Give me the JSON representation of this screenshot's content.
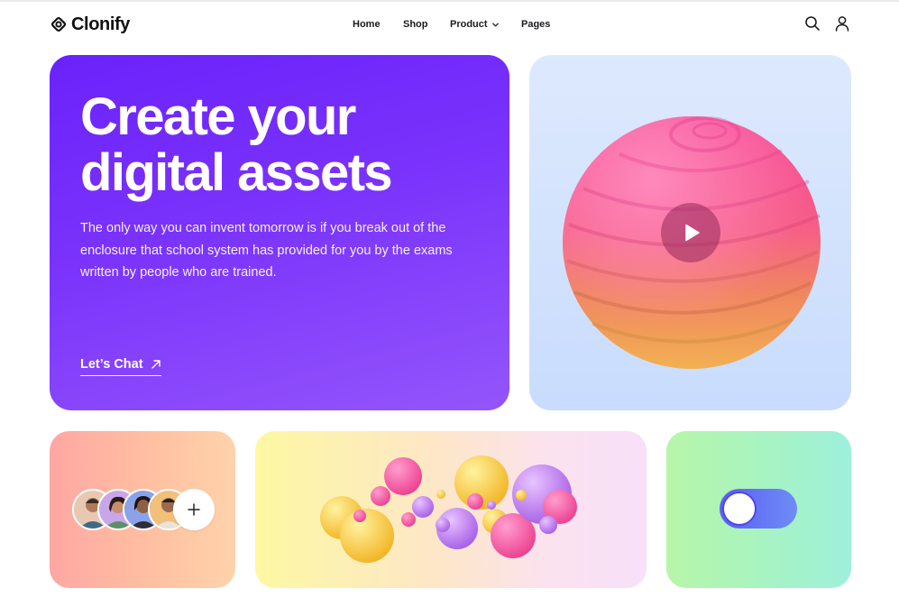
{
  "brand": {
    "name": "Clonify",
    "logo_icon": "diamond-ring-logo"
  },
  "nav": {
    "items": [
      {
        "label": "Home"
      },
      {
        "label": "Shop"
      },
      {
        "label": "Product",
        "icon": "chevron-down-icon"
      },
      {
        "label": "Pages"
      }
    ]
  },
  "header_icons": {
    "search": "search-icon",
    "account": "user-icon"
  },
  "hero": {
    "title": "Create your digital assets",
    "description": "The only way you can invent tomorrow is if you break out of the enclosure that school system has provided for you by the exams written by people who are trained.",
    "cta_label": "Let’s Chat",
    "cta_icon": "arrow-up-right-icon",
    "gradient": [
      "#6a22fb",
      "#9455fb"
    ]
  },
  "video_card": {
    "play_icon": "play-icon",
    "background": "#d6e4fd"
  },
  "team_card": {
    "avatar_count": 4,
    "add_icon": "plus-icon",
    "gradient": [
      "#ffa7a3",
      "#ffd3ac"
    ]
  },
  "bubbles_card": {
    "gradient": [
      "#fdf8a3",
      "#f7e0f9"
    ]
  },
  "toggle_card": {
    "state": "off",
    "gradient": [
      "#b7f6a8",
      "#9ef0dc"
    ],
    "toggle_color": "#5b5ef2"
  }
}
